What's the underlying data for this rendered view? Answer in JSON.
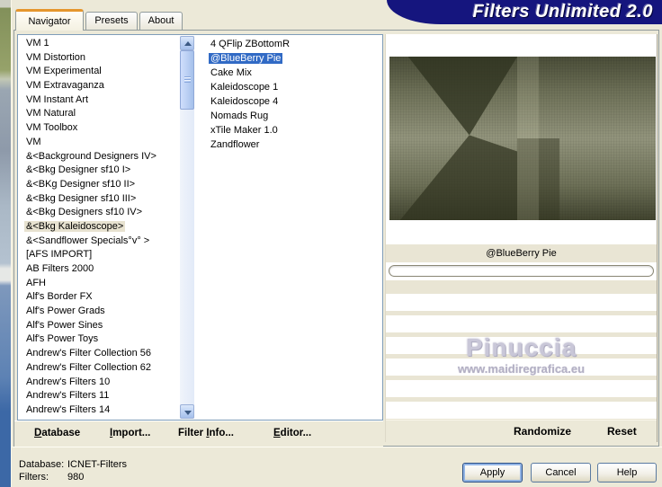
{
  "banner": {
    "title": "Filters Unlimited 2.0"
  },
  "tabs": [
    {
      "label": "Navigator",
      "active": true
    },
    {
      "label": "Presets",
      "active": false
    },
    {
      "label": "About",
      "active": false
    }
  ],
  "category_list": {
    "items": [
      {
        "label": "VM 1"
      },
      {
        "label": "VM Distortion"
      },
      {
        "label": "VM Experimental"
      },
      {
        "label": "VM Extravaganza"
      },
      {
        "label": "VM Instant Art"
      },
      {
        "label": "VM Natural"
      },
      {
        "label": "VM Toolbox"
      },
      {
        "label": "VM"
      },
      {
        "label": "&<Background Designers IV>"
      },
      {
        "label": "&<Bkg Designer sf10 I>"
      },
      {
        "label": "&<BKg Designer sf10 II>"
      },
      {
        "label": "&<Bkg Designer sf10 III>"
      },
      {
        "label": "&<Bkg Designers sf10 IV>"
      },
      {
        "label": "&<Bkg Kaleidoscope>",
        "selected": true
      },
      {
        "label": "&<Sandflower Specials°v° >"
      },
      {
        "label": "[AFS IMPORT]"
      },
      {
        "label": "AB Filters 2000"
      },
      {
        "label": "AFH"
      },
      {
        "label": "Alf's Border FX"
      },
      {
        "label": "Alf's Power Grads"
      },
      {
        "label": "Alf's Power Sines"
      },
      {
        "label": "Alf's Power Toys"
      },
      {
        "label": "Andrew's Filter Collection 56"
      },
      {
        "label": "Andrew's Filter Collection 62"
      },
      {
        "label": "Andrew's Filters 10"
      },
      {
        "label": "Andrew's Filters 11"
      },
      {
        "label": "Andrew's Filters 14"
      }
    ]
  },
  "filter_list": {
    "items": [
      {
        "label": "4 QFlip ZBottomR"
      },
      {
        "label": "@BlueBerry Pie",
        "selected": true
      },
      {
        "label": "Cake Mix"
      },
      {
        "label": "Kaleidoscope 1"
      },
      {
        "label": "Kaleidoscope 4"
      },
      {
        "label": "Nomads Rug"
      },
      {
        "label": "xTile Maker 1.0"
      },
      {
        "label": "Zandflower"
      }
    ]
  },
  "preview": {
    "filter_label": "@BlueBerry Pie",
    "watermark_title": "Pinuccia",
    "watermark_url": "www.maidiregrafica.eu"
  },
  "menu_bar": {
    "items": [
      {
        "pre": "",
        "key": "D",
        "post": "atabase"
      },
      {
        "pre": "",
        "key": "I",
        "post": "mport..."
      },
      {
        "pre": "Filter ",
        "key": "I",
        "post": "nfo..."
      },
      {
        "pre": "",
        "key": "E",
        "post": "ditor..."
      }
    ]
  },
  "actions": {
    "randomize": "Randomize",
    "reset": "Reset"
  },
  "status": {
    "database_label": "Database:",
    "database_value": "ICNET-Filters",
    "filters_label": "Filters:",
    "filters_value": "980"
  },
  "footer_buttons": {
    "apply": "Apply",
    "cancel": "Cancel",
    "help": "Help"
  },
  "colors": {
    "banner_navy": "#15157e",
    "selection_blue": "#316ac5",
    "inactive_selection": "#e7e2d0",
    "dialog_beige": "#ece9d8",
    "tab_accent_orange": "#e5962d"
  }
}
